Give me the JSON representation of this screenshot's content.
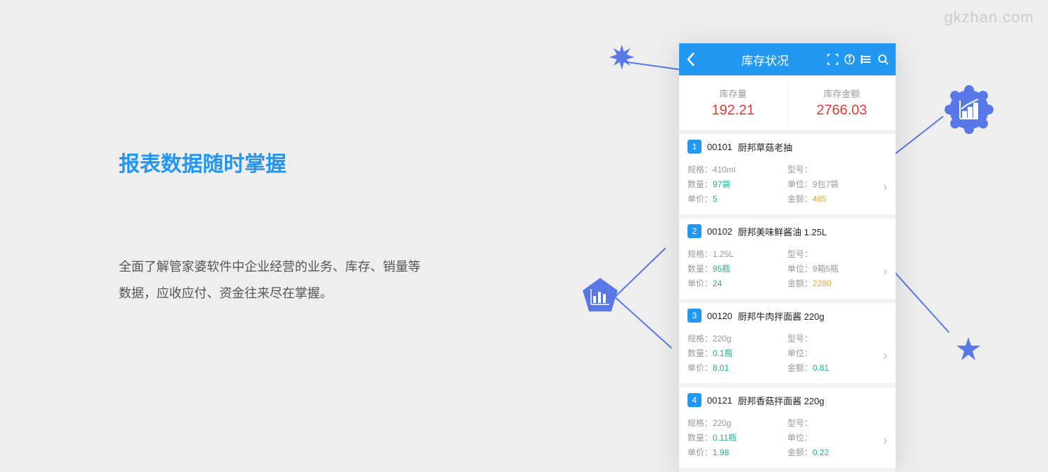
{
  "watermark": "gkzhan.com",
  "main_title": "报表数据随时掌握",
  "description": "全面了解管家婆软件中企业经营的业务、库存、销量等数据，应收应付、资金往来尽在掌握。",
  "app": {
    "title": "库存状况",
    "summary": {
      "stock_label": "库存量",
      "stock_value": "192.21",
      "amount_label": "库存金额",
      "amount_value": "2766.03"
    },
    "labels": {
      "spec": "规格：",
      "model": "型号：",
      "qty": "数量：",
      "unit": "单位：",
      "price": "单价：",
      "amount": "金额："
    },
    "items": [
      {
        "index": "1",
        "code": "00101",
        "name": "厨邦草菇老抽",
        "spec": "410ml",
        "model": "",
        "qty": "97袋",
        "unit": "9包7袋",
        "price": "5",
        "amount": "485",
        "amount_color": "orange"
      },
      {
        "index": "2",
        "code": "00102",
        "name": "厨邦美味鲜酱油 1.25L",
        "spec": "1.25L",
        "model": "",
        "qty": "95瓶",
        "unit": "9箱5瓶",
        "price": "24",
        "amount": "2280",
        "amount_color": "orange"
      },
      {
        "index": "3",
        "code": "00120",
        "name": "厨邦牛肉拌面酱 220g",
        "spec": "220g",
        "model": "",
        "qty": "0.1瓶",
        "unit": "",
        "price": "8.01",
        "amount": "0.81",
        "amount_color": "green"
      },
      {
        "index": "4",
        "code": "00121",
        "name": "厨邦香菇拌面酱 220g",
        "spec": "220g",
        "model": "",
        "qty": "0.11瓶",
        "unit": "",
        "price": "1.98",
        "amount": "0.22",
        "amount_color": "green"
      }
    ]
  }
}
